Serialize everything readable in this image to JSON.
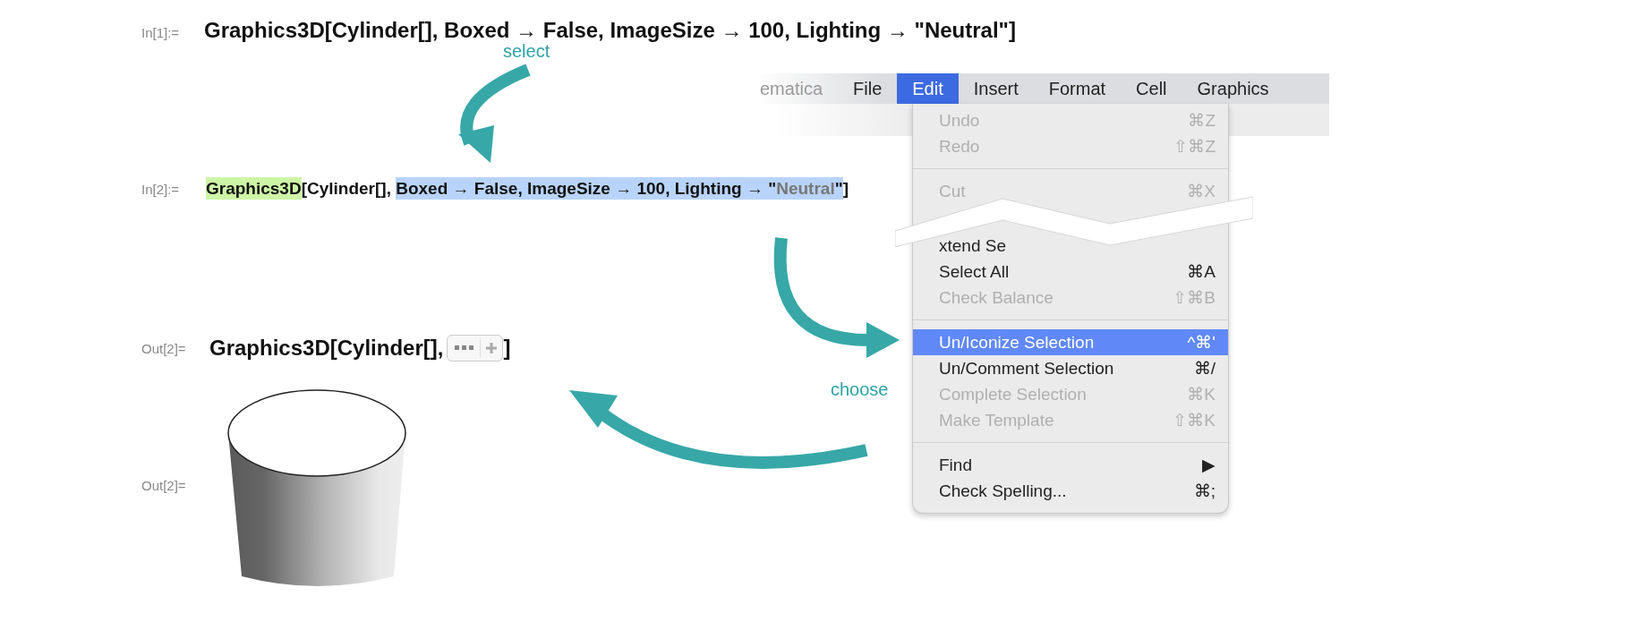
{
  "input_1": {
    "label": "In[1]:=",
    "code": "Graphics3D[Cylinder[], Boxed → False, ImageSize → 100, Lighting → \"Neutral\"]"
  },
  "input_2": {
    "label": "In[2]:=",
    "segments": [
      {
        "text": "Graphics3D",
        "kind": "head"
      },
      {
        "text": "[Cylinder[], ",
        "kind": "plain"
      },
      {
        "text": "Boxed → False, ImageSize → 100, Lighting → \"",
        "kind": "selected"
      },
      {
        "text": "Neutral",
        "kind": "selected-string"
      },
      {
        "text": "\"",
        "kind": "selected"
      },
      {
        "text": "]",
        "kind": "plain"
      }
    ]
  },
  "output_1": {
    "label": "Out[2]=",
    "code_before": "Graphics3D[Cylinder[], ",
    "code_after": "]"
  },
  "output_2": {
    "label": "Out[2]=",
    "kind": "picture"
  },
  "annotations": [
    {
      "text": "select"
    },
    {
      "text": "choose"
    }
  ],
  "menubar": [
    {
      "label": "ematica",
      "selected": false,
      "faded": true
    },
    {
      "label": "File",
      "selected": false,
      "faded": false
    },
    {
      "label": "Edit",
      "selected": true,
      "faded": false
    },
    {
      "label": "Insert",
      "selected": false,
      "faded": false
    },
    {
      "label": "Format",
      "selected": false,
      "faded": false
    },
    {
      "label": "Cell",
      "selected": false,
      "faded": false
    },
    {
      "label": "Graphics",
      "selected": false,
      "faded": false
    }
  ],
  "menu": [
    {
      "kind": "item",
      "label": "Undo",
      "shortcut": "⌘Z",
      "disabled": true,
      "selected": false
    },
    {
      "kind": "item",
      "label": "Redo",
      "shortcut": "⇧⌘Z",
      "disabled": true,
      "selected": false
    },
    {
      "kind": "separator"
    },
    {
      "kind": "item",
      "label": "Cut",
      "shortcut": "⌘X",
      "disabled": true,
      "selected": false
    },
    {
      "kind": "tear",
      "label": "xtend Se"
    },
    {
      "kind": "item",
      "label": "Select All",
      "shortcut": "⌘A",
      "disabled": false,
      "selected": false
    },
    {
      "kind": "item",
      "label": "Check Balance",
      "shortcut": "⇧⌘B",
      "disabled": true,
      "selected": false
    },
    {
      "kind": "separator"
    },
    {
      "kind": "item",
      "label": "Un/Iconize Selection",
      "shortcut": "^⌘'",
      "disabled": false,
      "selected": true
    },
    {
      "kind": "item",
      "label": "Un/Comment Selection",
      "shortcut": "⌘/",
      "disabled": false,
      "selected": false
    },
    {
      "kind": "item",
      "label": "Complete Selection",
      "shortcut": "⌘K",
      "disabled": true,
      "selected": false
    },
    {
      "kind": "item",
      "label": "Make Template",
      "shortcut": "⇧⌘K",
      "disabled": true,
      "selected": false
    },
    {
      "kind": "separator"
    },
    {
      "kind": "item",
      "label": "Find",
      "shortcut": "▶",
      "disabled": false,
      "selected": false
    },
    {
      "kind": "item",
      "label": "Check Spelling...",
      "shortcut": "⌘;",
      "disabled": false,
      "selected": false
    }
  ]
}
